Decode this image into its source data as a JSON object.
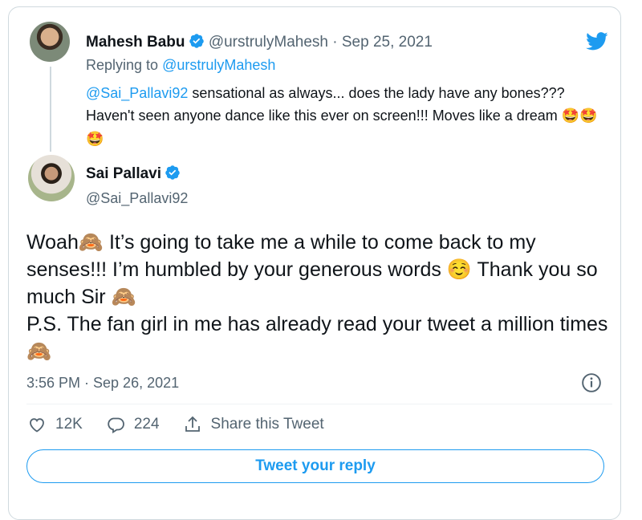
{
  "quoted": {
    "author_name": "Mahesh Babu",
    "author_handle": "@urstrulyMahesh",
    "separator": "·",
    "date": "Sep 25, 2021",
    "replying_to_prefix": "Replying to",
    "replying_to_handle": "@urstrulyMahesh",
    "mention": "@Sai_Pallavi92",
    "text": " sensational as always... does the lady have any bones??? Haven't seen anyone dance like this ever on screen!!! Moves like a dream ",
    "emoji": "🤩🤩🤩"
  },
  "tweet": {
    "author_name": "Sai Pallavi",
    "author_handle": "@Sai_Pallavi92",
    "line1a": "Woah",
    "emoji_monkey": "🙈",
    "line1b": " It’s going to take me a while to come back to my senses!!! I’m humbled by your generous words ",
    "emoji_blush": "☺️",
    "line1c": " Thank you so much Sir ",
    "line2": "P.S. The fan girl in me has already read your tweet a million times ",
    "timestamp": "3:56 PM · Sep 26, 2021"
  },
  "actions": {
    "likes": "12K",
    "comments": "224",
    "share_label": "Share this Tweet"
  },
  "reply_button": {
    "label": "Tweet your reply"
  },
  "colors": {
    "accent": "#1d9bf0",
    "text": "#0f1419",
    "muted": "#536471",
    "border": "#cfd9de"
  },
  "icons": [
    "twitter-logo-icon",
    "verified-badge-icon",
    "info-icon",
    "heart-icon",
    "comment-icon",
    "share-icon"
  ]
}
